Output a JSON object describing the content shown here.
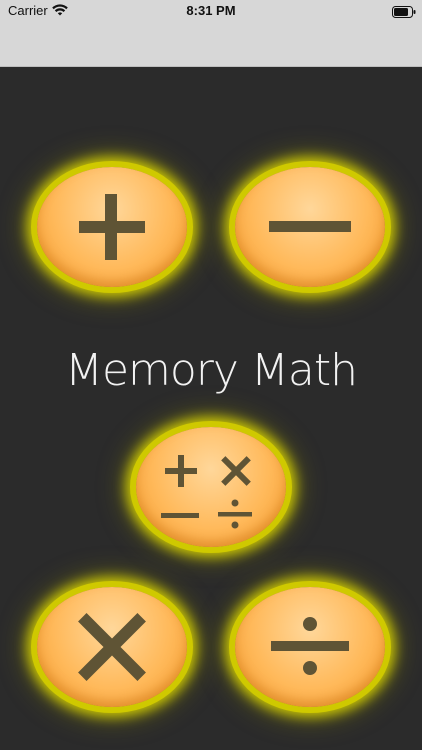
{
  "status_bar": {
    "carrier": "Carrier",
    "time": "8:31 PM"
  },
  "app": {
    "title": "Memory Math"
  },
  "buttons": {
    "add": {
      "icon": "plus-icon"
    },
    "subtract": {
      "icon": "minus-icon"
    },
    "mixed": {
      "icon": "mixed-operations-icon"
    },
    "multiply": {
      "icon": "multiply-icon"
    },
    "divide": {
      "icon": "divide-icon"
    }
  },
  "colors": {
    "background": "#2b2b2b",
    "button_fill": "#ffb95a",
    "button_glow": "#cfc900",
    "symbol": "#5f5435",
    "title_text": "#f2f2f2"
  }
}
